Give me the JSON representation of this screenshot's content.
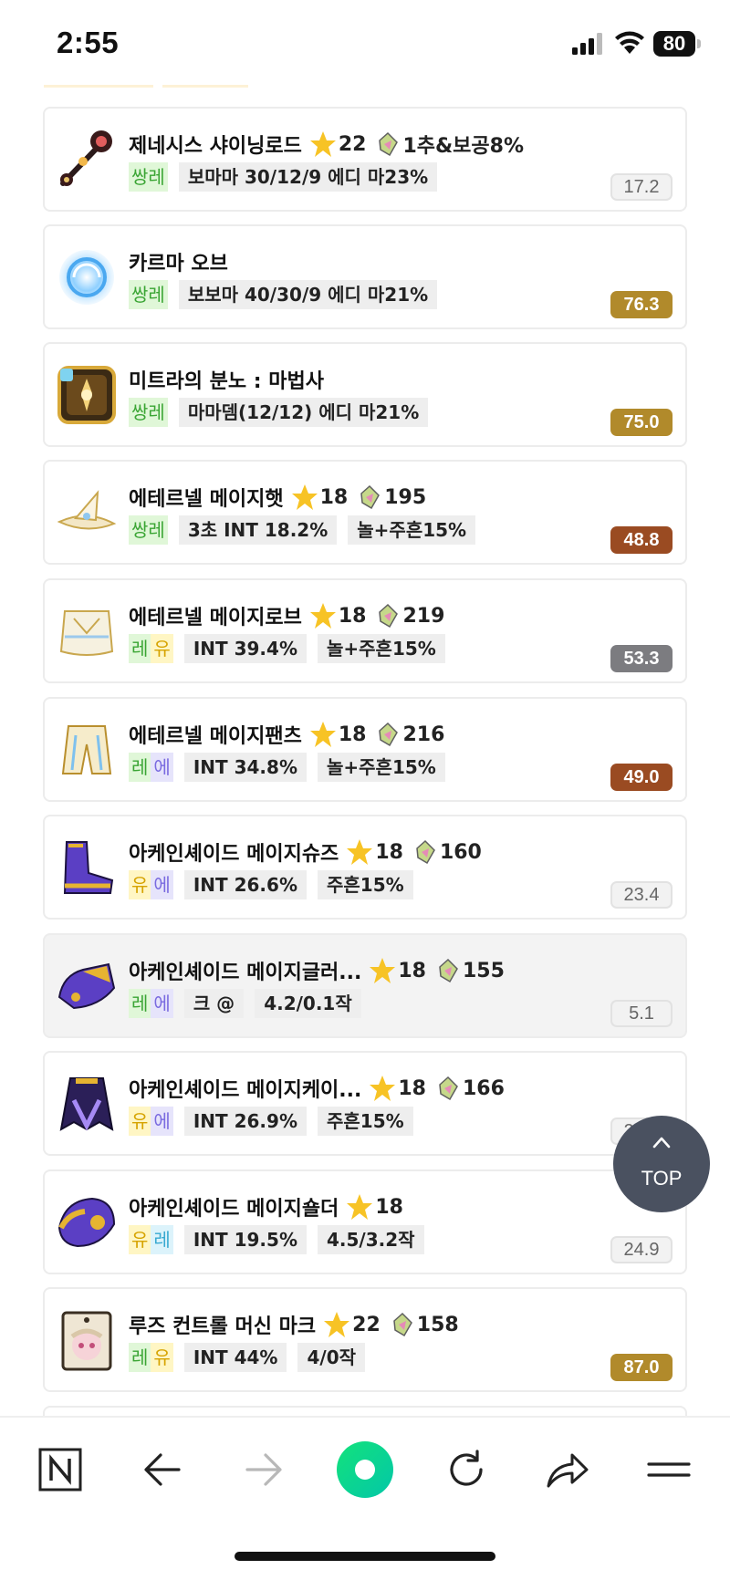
{
  "status_bar": {
    "time": "2:55",
    "battery": "80"
  },
  "items": [
    {
      "name": "제네시스 샤이닝로드",
      "star": "22",
      "gem": "1추&보공8%",
      "grade": [
        "쌍레"
      ],
      "options": [
        "보마마 30/12/9 에디 마23%"
      ],
      "score": "17.2",
      "score_style": "plain",
      "icon": "genesis-staff-icon"
    },
    {
      "name": "카르마 오브",
      "star": "",
      "gem": "",
      "grade": [
        "쌍레"
      ],
      "options": [
        "보보마 40/30/9 에디 마21%"
      ],
      "score": "76.3",
      "score_style": "gold",
      "icon": "karma-orb-icon"
    },
    {
      "name": "미트라의 분노 : 마법사",
      "star": "",
      "gem": "",
      "grade": [
        "쌍레"
      ],
      "options": [
        "마마뎀(12/12) 에디 마21%"
      ],
      "score": "75.0",
      "score_style": "gold",
      "icon": "mitra-emblem-icon"
    },
    {
      "name": "에테르넬 메이지햇",
      "star": "18",
      "gem": "195",
      "grade": [
        "쌍레"
      ],
      "options": [
        "3초 INT 18.2%",
        "놀+주흔15%"
      ],
      "score": "48.8",
      "score_style": "brown",
      "icon": "eternal-hat-icon"
    },
    {
      "name": "에테르넬 메이지로브",
      "star": "18",
      "gem": "219",
      "grade": [
        "레유"
      ],
      "options": [
        "INT 39.4%",
        "놀+주흔15%"
      ],
      "score": "53.3",
      "score_style": "gray",
      "icon": "eternal-robe-icon"
    },
    {
      "name": "에테르넬 메이지팬츠",
      "star": "18",
      "gem": "216",
      "grade": [
        "레에"
      ],
      "options": [
        "INT 34.8%",
        "놀+주흔15%"
      ],
      "score": "49.0",
      "score_style": "brown",
      "icon": "eternal-pants-icon"
    },
    {
      "name": "아케인셰이드 메이지슈즈",
      "star": "18",
      "gem": "160",
      "grade": [
        "유에"
      ],
      "options": [
        "INT 26.6%",
        "주흔15%"
      ],
      "score": "23.4",
      "score_style": "plain",
      "icon": "arcane-shoes-icon"
    },
    {
      "name": "아케인셰이드 메이지글러...",
      "star": "18",
      "gem": "155",
      "grade": [
        "레에"
      ],
      "options": [
        "크 @",
        "4.2/0.1작"
      ],
      "score": "5.1",
      "score_style": "plain",
      "icon": "arcane-gloves-icon"
    },
    {
      "name": "아케인셰이드 메이지케이...",
      "star": "18",
      "gem": "166",
      "grade": [
        "유에"
      ],
      "options": [
        "INT 26.9%",
        "주흔15%"
      ],
      "score": "24.0",
      "score_style": "plain",
      "icon": "arcane-cape-icon"
    },
    {
      "name": "아케인셰이드 메이지숄더",
      "star": "18",
      "gem": "",
      "grade": [
        "유레"
      ],
      "options": [
        "INT 19.5%",
        "4.5/3.2작"
      ],
      "score": "24.9",
      "score_style": "plain",
      "icon": "arcane-shoulder-icon"
    },
    {
      "name": "루즈 컨트롤 머신 마크",
      "star": "22",
      "gem": "158",
      "grade": [
        "레유"
      ],
      "options": [
        "INT 44%",
        "4/0작"
      ],
      "score": "87.0",
      "score_style": "gold",
      "icon": "machine-mark-icon"
    }
  ],
  "top_button": {
    "label": "TOP"
  },
  "colors": {
    "score_gold": "#b18a2b",
    "score_brown": "#9a4b22",
    "score_gray": "#7c7c80",
    "top_button": "#4a5160",
    "brand_green": "#03c75a"
  }
}
